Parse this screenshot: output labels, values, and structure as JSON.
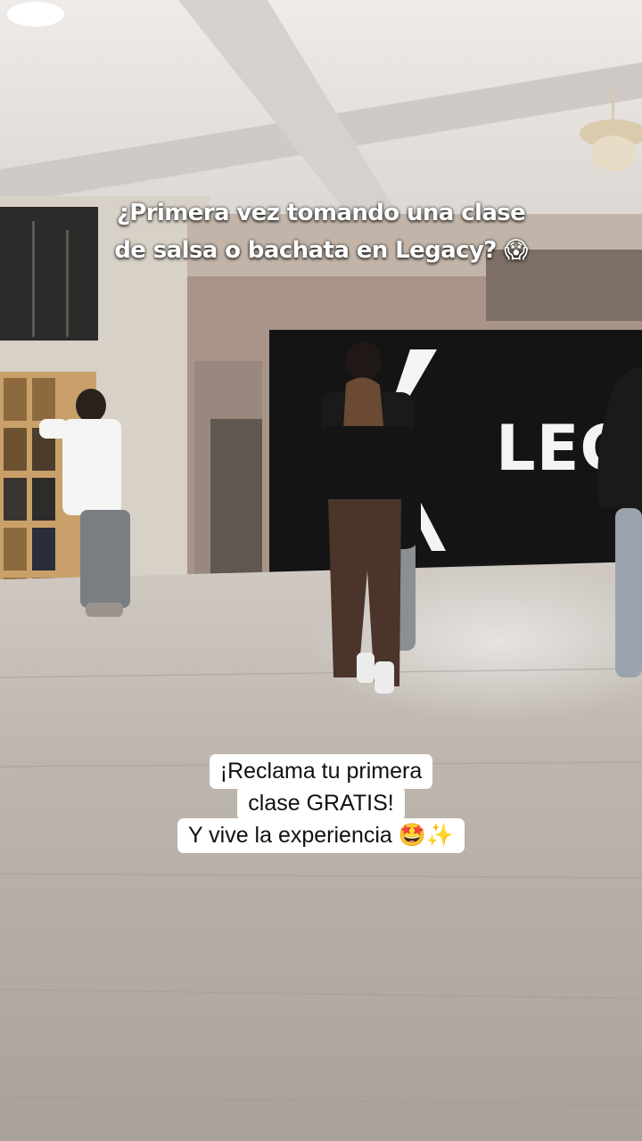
{
  "caption_top": {
    "line1": "¿Primera vez tomando una clase",
    "line2": "de salsa o bachata en Legacy? 😱"
  },
  "caption_bottom": {
    "line1": "¡Reclama tu primera",
    "line2": "clase GRATIS!",
    "line3": "Y vive la experiencia 🤩✨"
  },
  "wall_sign": {
    "text": "LEG"
  },
  "colors": {
    "floor": "#b8b2ab",
    "ceiling": "#e7e4e1",
    "wall": "#d8d1c8",
    "back_wall": "#9a8b80",
    "sign_panel": "#141414",
    "sign_text": "#f4f4f4"
  }
}
